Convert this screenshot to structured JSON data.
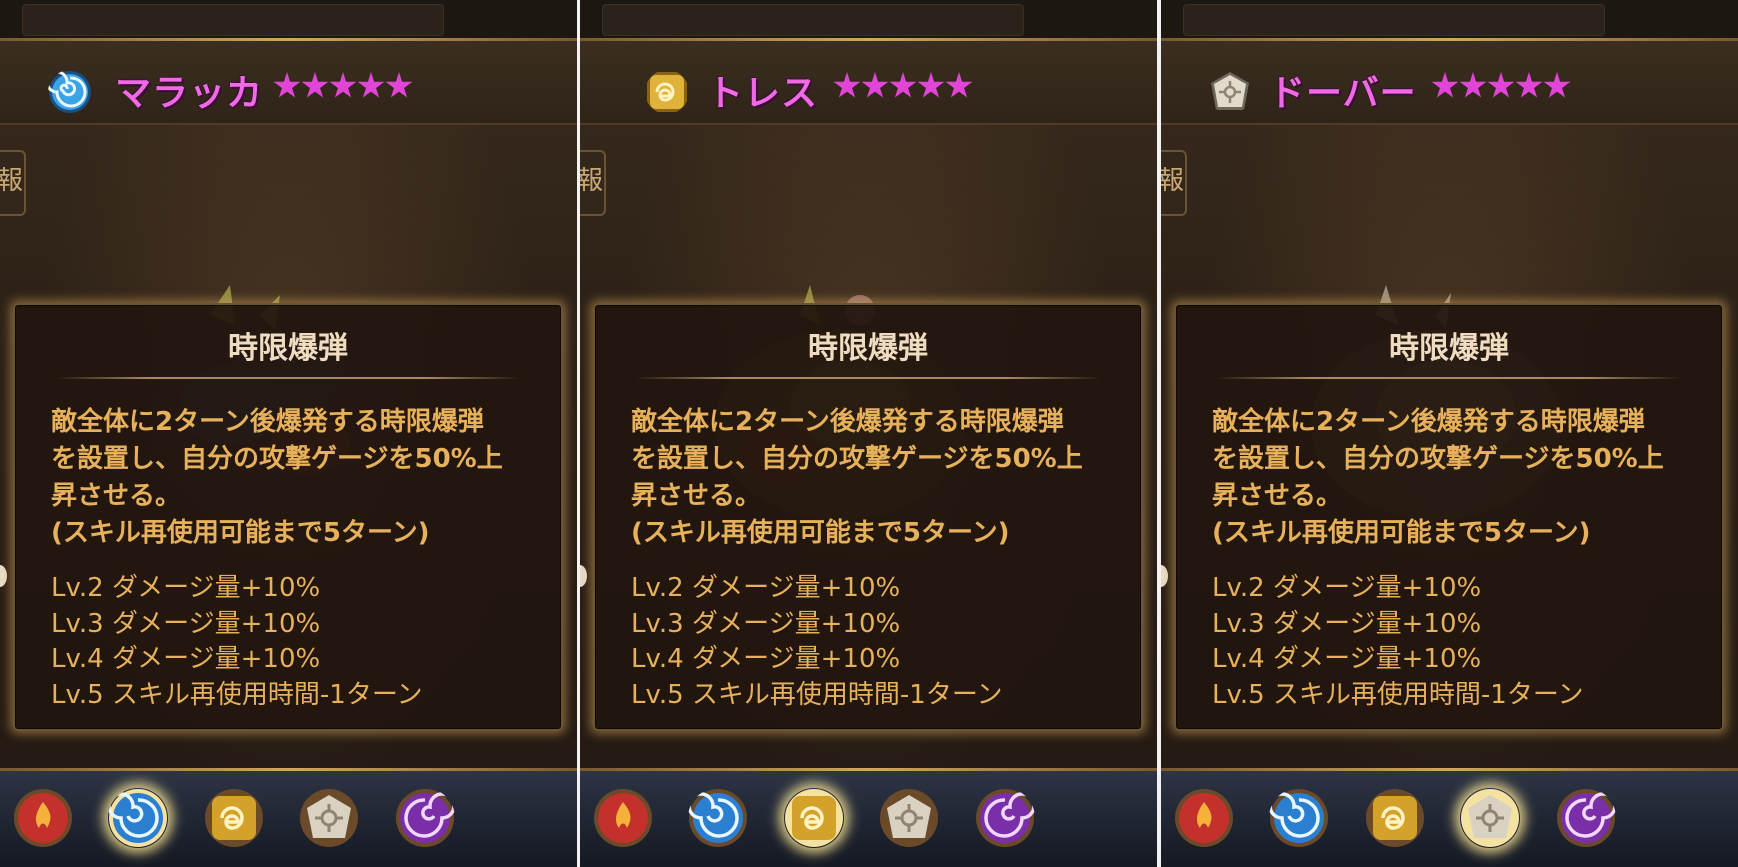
{
  "panels": [
    {
      "monster_name": "マラッカ",
      "header_element": "water-spiral-icon",
      "star_count": 5,
      "side_tab_glyph": "報",
      "skill": {
        "title": "時限爆弾",
        "description": [
          "敵全体に2ターン後爆発する時限爆弾",
          "を設置し、自分の攻撃ゲージを50%上",
          "昇させる。",
          "(スキル再使用可能まで5ターン)"
        ],
        "levels": [
          "Lv.2 ダメージ量+10%",
          "Lv.3 ダメージ量+10%",
          "Lv.4 ダメージ量+10%",
          "Lv.5 スキル再使用時間-1ターン"
        ]
      },
      "selected_element": "water"
    },
    {
      "monster_name": "トレス",
      "header_element": "wind-swirl-icon",
      "star_count": 5,
      "side_tab_glyph": "報",
      "skill": {
        "title": "時限爆弾",
        "description": [
          "敵全体に2ターン後爆発する時限爆弾",
          "を設置し、自分の攻撃ゲージを50%上",
          "昇させる。",
          "(スキル再使用可能まで5ターン)"
        ],
        "levels": [
          "Lv.2 ダメージ量+10%",
          "Lv.3 ダメージ量+10%",
          "Lv.4 ダメージ量+10%",
          "Lv.5 スキル再使用時間-1ターン"
        ]
      },
      "selected_element": "wind"
    },
    {
      "monster_name": "ドーバー",
      "header_element": "light-sun-icon",
      "star_count": 5,
      "side_tab_glyph": "報",
      "skill": {
        "title": "時限爆弾",
        "description": [
          "敵全体に2ターン後爆発する時限爆弾",
          "を設置し、自分の攻撃ゲージを50%上",
          "昇させる。",
          "(スキル再使用可能まで5ターン)"
        ],
        "levels": [
          "Lv.2 ダメージ量+10%",
          "Lv.3 ダメージ量+10%",
          "Lv.4 ダメージ量+10%",
          "Lv.5 スキル再使用時間-1ターン"
        ]
      },
      "selected_element": "light"
    }
  ],
  "element_buttons": [
    {
      "id": "fire",
      "icon": "fire-element-icon",
      "color": "#c4302b"
    },
    {
      "id": "water",
      "icon": "water-element-icon",
      "color": "#2a7fd0"
    },
    {
      "id": "wind",
      "icon": "wind-element-icon",
      "color": "#d4a22a"
    },
    {
      "id": "light",
      "icon": "light-element-icon",
      "color": "#d9d2c2"
    },
    {
      "id": "dark",
      "icon": "dark-element-icon",
      "color": "#7a2fa8"
    }
  ],
  "colors": {
    "name_pink": "#f06ae6",
    "star_pink": "#e244d8",
    "skill_text": "#e6b15a",
    "skill_title": "#f0dcc0",
    "tooltip_border": "#6b5430",
    "gold_trim": "#d1a85a"
  }
}
